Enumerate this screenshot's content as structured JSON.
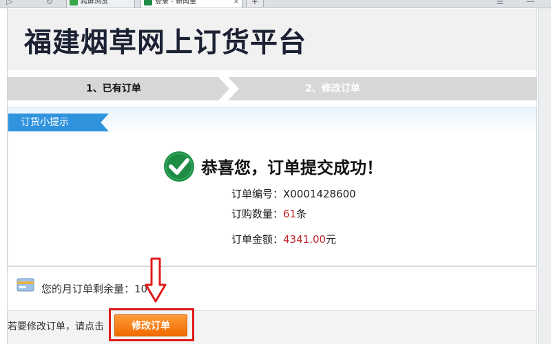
{
  "browser": {
    "tabs": [
      {
        "label": "跨屏浏览",
        "active": false
      },
      {
        "label": "登录 - 新闻量",
        "active": true
      }
    ],
    "new_tab_label": "+",
    "tab_close_glyph": "×"
  },
  "header": {
    "title": "福建烟草网上订货平台"
  },
  "steps": [
    {
      "label": "1、已有订单",
      "active": true
    },
    {
      "label": "2、修改订单",
      "active": false
    }
  ],
  "panel": {
    "tag": "订货小提示",
    "success_message": "恭喜您，订单提交成功！",
    "order_number_label": "订单编号：",
    "order_number": "X0001428600",
    "quantity_label": "订购数量：",
    "quantity_value": "61",
    "quantity_unit": "条",
    "amount_label": "订单金额：",
    "amount_value": "4341.00",
    "amount_unit": "元",
    "remaining_label": "您的月订单剩余量：",
    "remaining_value": "10",
    "remaining_unit": "条"
  },
  "footer": {
    "hint": "若要修改订单，请点击",
    "modify_button": "修改订单"
  },
  "colors": {
    "accent_blue": "#2f93dd",
    "success_green": "#1f8c45",
    "value_red": "#c0242a",
    "button_orange": "#f06a00",
    "highlight_red": "#e01a1a"
  },
  "icons": {
    "success": "check-circle-icon",
    "card": "card-icon",
    "arrow": "down-arrow-icon"
  }
}
